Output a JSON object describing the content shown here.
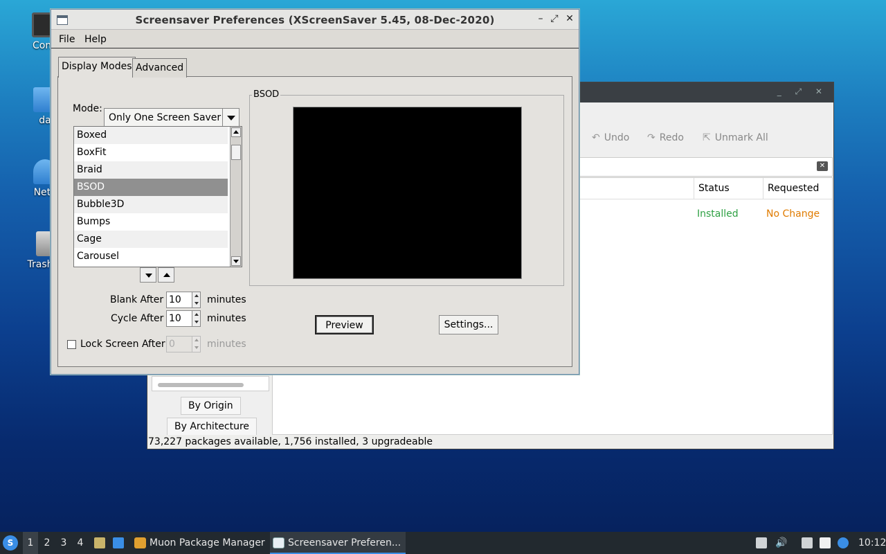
{
  "desktop": {
    "icons": [
      {
        "label": "Com",
        "icon": "computer-icon"
      },
      {
        "label": "da",
        "icon": "folder-icon"
      },
      {
        "label": "Netv",
        "icon": "network-icon"
      },
      {
        "label": "Trash (",
        "icon": "trash-icon"
      }
    ]
  },
  "muon": {
    "toolbar": {
      "undo": "Undo",
      "redo": "Redo",
      "unmark_all": "Unmark All"
    },
    "columns": {
      "status": "Status",
      "requested": "Requested"
    },
    "row": {
      "status": "Installed",
      "requested": "No Change"
    },
    "side": {
      "by_origin": "By Origin",
      "by_architecture": "By Architecture"
    },
    "statusbar": "73,227 packages available, 1,756 installed, 3 upgradeable",
    "colors": {
      "installed": "#2ea043",
      "no_change": "#e07b00"
    }
  },
  "xss": {
    "title": "Screensaver Preferences  (XScreenSaver 5.45, 08-Dec-2020)",
    "menu": {
      "file": "File",
      "help": "Help"
    },
    "tabs": {
      "display_modes": "Display Modes",
      "advanced": "Advanced"
    },
    "mode_label": "Mode:",
    "mode_value": "Only One Screen Saver",
    "list": [
      "Boxed",
      "BoxFit",
      "Braid",
      "BSOD",
      "Bubble3D",
      "Bumps",
      "Cage",
      "Carousel"
    ],
    "selected": "BSOD",
    "blank_after": {
      "label": "Blank After",
      "value": "10",
      "unit": "minutes"
    },
    "cycle_after": {
      "label": "Cycle After",
      "value": "10",
      "unit": "minutes"
    },
    "lock_after": {
      "label": "Lock Screen After",
      "value": "0",
      "unit": "minutes",
      "checked": false
    },
    "preview_frame_label": "BSOD",
    "preview_button": "Preview",
    "settings_button": "Settings..."
  },
  "taskbar": {
    "workspaces": [
      "1",
      "2",
      "3",
      "4"
    ],
    "active_workspace": "1",
    "tasks": [
      {
        "label": "Muon Package Manager",
        "icon": "package-icon"
      },
      {
        "label": "Screensaver Preferen...",
        "icon": "window-icon"
      }
    ],
    "clock": "10:12"
  }
}
